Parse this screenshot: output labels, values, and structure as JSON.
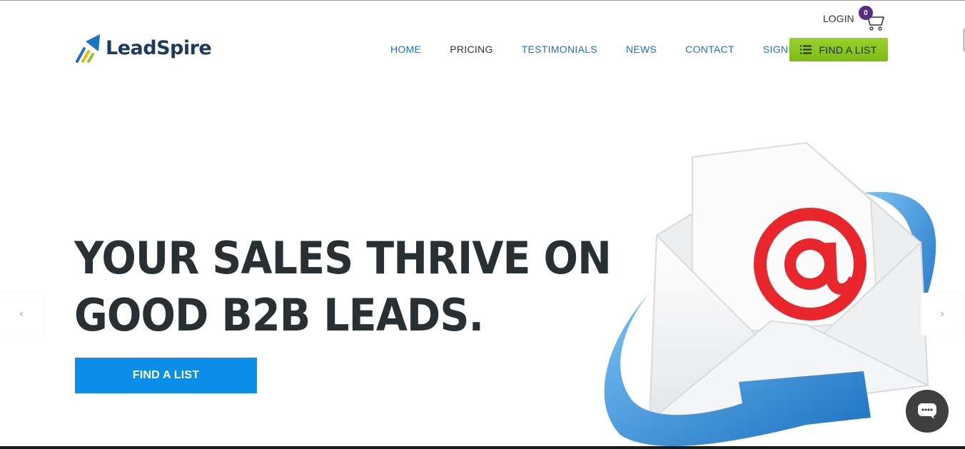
{
  "brand": {
    "name": "LeadSpire",
    "colors": {
      "navy": "#1e3a5f",
      "blue": "#1a73c9",
      "green": "#8bc61f",
      "cta": "#0a8ee8",
      "red": "#e8262b"
    }
  },
  "topbar": {
    "login": "LOGIN",
    "cart_count": "0",
    "cart_icon": "shopping-cart-icon"
  },
  "nav": {
    "items": [
      "HOME",
      "PRICING",
      "TESTIMONIALS",
      "NEWS",
      "CONTACT",
      "SIGNIN"
    ],
    "active": "PRICING"
  },
  "header_cta": {
    "label": "FIND A LIST",
    "icon": "list-icon"
  },
  "hero": {
    "title_line1": "YOUR SALES THRIVE ON",
    "title_line2": "GOOD B2B LEADS.",
    "cta_label": "FIND A LIST",
    "image": "email-envelope-at-sign-illustration"
  },
  "slider": {
    "prev": "‹",
    "next": "›"
  },
  "chat": {
    "icon": "chat-bubble-icon"
  }
}
